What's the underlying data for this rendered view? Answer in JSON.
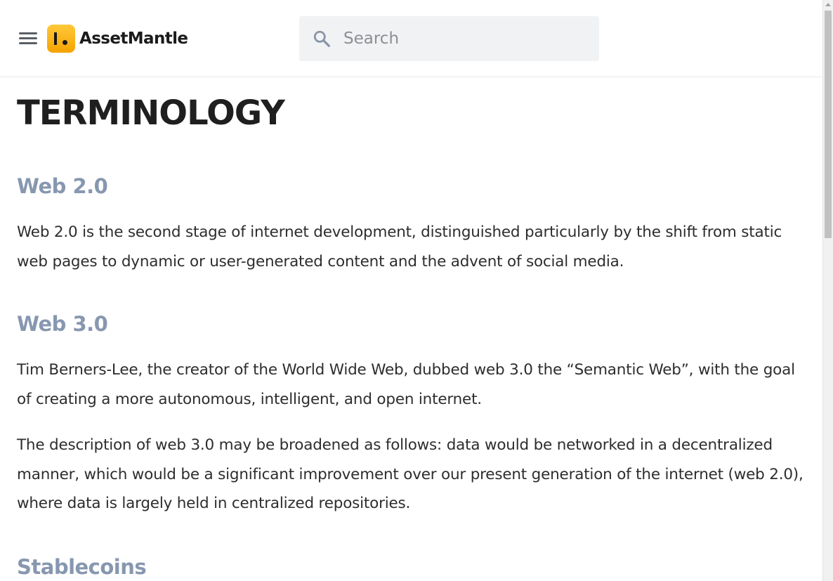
{
  "header": {
    "brand": "AssetMantle",
    "search": {
      "placeholder": "Search",
      "value": ""
    },
    "icons": {
      "menu": "hamburger-menu-icon",
      "search": "search-icon",
      "logo": "assetmantle-logo-icon"
    }
  },
  "main": {
    "title": "TERMINOLOGY",
    "sections": [
      {
        "heading": "Web 2.0",
        "paragraphs": [
          "Web 2.0 is the second stage of internet development, distinguished particularly by the shift from static web pages to dynamic or user-generated content and the advent of social media."
        ]
      },
      {
        "heading": "Web 3.0",
        "paragraphs": [
          "Tim Berners-Lee, the creator of the World Wide Web, dubbed web 3.0 the “Semantic Web”, with the goal of creating a more autonomous, intelligent, and open internet.",
          "The description of web 3.0 may be broadened as follows: data would be networked in a decentralized manner, which would be a significant improvement over our present generation of the internet (web 2.0), where data is largely held in centralized repositories."
        ]
      },
      {
        "heading": "Stablecoins",
        "paragraphs": []
      }
    ]
  },
  "colors": {
    "section_heading": "#8797b0",
    "logo_accent": "#f5a300",
    "search_bg": "#f1f2f4"
  }
}
